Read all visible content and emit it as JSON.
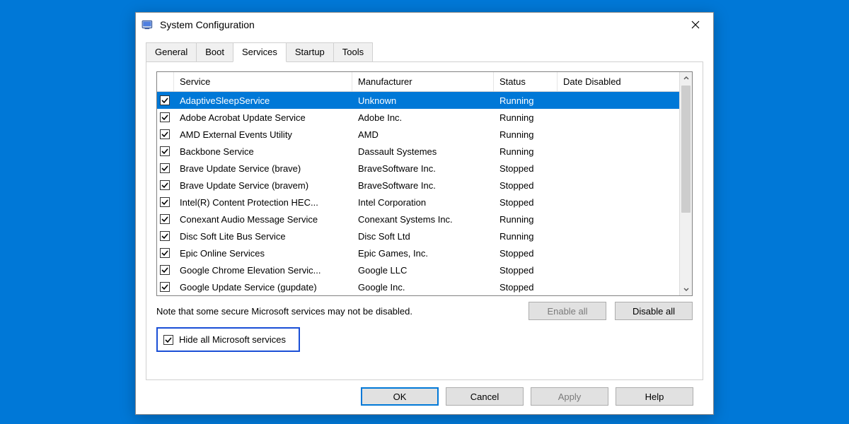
{
  "window": {
    "title": "System Configuration"
  },
  "tabs": {
    "items": [
      "General",
      "Boot",
      "Services",
      "Startup",
      "Tools"
    ],
    "active": "Services"
  },
  "columns": {
    "service": "Service",
    "manufacturer": "Manufacturer",
    "status": "Status",
    "date_disabled": "Date Disabled"
  },
  "rows": [
    {
      "checked": true,
      "selected": true,
      "service": "AdaptiveSleepService",
      "manufacturer": "Unknown",
      "status": "Running",
      "date_disabled": ""
    },
    {
      "checked": true,
      "selected": false,
      "service": "Adobe Acrobat Update Service",
      "manufacturer": "Adobe Inc.",
      "status": "Running",
      "date_disabled": ""
    },
    {
      "checked": true,
      "selected": false,
      "service": "AMD External Events Utility",
      "manufacturer": "AMD",
      "status": "Running",
      "date_disabled": ""
    },
    {
      "checked": true,
      "selected": false,
      "service": "Backbone Service",
      "manufacturer": "Dassault Systemes",
      "status": "Running",
      "date_disabled": ""
    },
    {
      "checked": true,
      "selected": false,
      "service": "Brave Update Service (brave)",
      "manufacturer": "BraveSoftware Inc.",
      "status": "Stopped",
      "date_disabled": ""
    },
    {
      "checked": true,
      "selected": false,
      "service": "Brave Update Service (bravem)",
      "manufacturer": "BraveSoftware Inc.",
      "status": "Stopped",
      "date_disabled": ""
    },
    {
      "checked": true,
      "selected": false,
      "service": "Intel(R) Content Protection HEC...",
      "manufacturer": "Intel Corporation",
      "status": "Stopped",
      "date_disabled": ""
    },
    {
      "checked": true,
      "selected": false,
      "service": "Conexant Audio Message Service",
      "manufacturer": "Conexant Systems Inc.",
      "status": "Running",
      "date_disabled": ""
    },
    {
      "checked": true,
      "selected": false,
      "service": "Disc Soft Lite Bus Service",
      "manufacturer": "Disc Soft Ltd",
      "status": "Running",
      "date_disabled": ""
    },
    {
      "checked": true,
      "selected": false,
      "service": "Epic Online Services",
      "manufacturer": "Epic Games, Inc.",
      "status": "Stopped",
      "date_disabled": ""
    },
    {
      "checked": true,
      "selected": false,
      "service": "Google Chrome Elevation Servic...",
      "manufacturer": "Google LLC",
      "status": "Stopped",
      "date_disabled": ""
    },
    {
      "checked": true,
      "selected": false,
      "service": "Google Update Service (gupdate)",
      "manufacturer": "Google Inc.",
      "status": "Stopped",
      "date_disabled": ""
    }
  ],
  "note": "Note that some secure Microsoft services may not be disabled.",
  "buttons": {
    "enable_all": "Enable all",
    "disable_all": "Disable all",
    "ok": "OK",
    "cancel": "Cancel",
    "apply": "Apply",
    "help": "Help"
  },
  "hide_checkbox": {
    "label": "Hide all Microsoft services",
    "checked": true
  }
}
